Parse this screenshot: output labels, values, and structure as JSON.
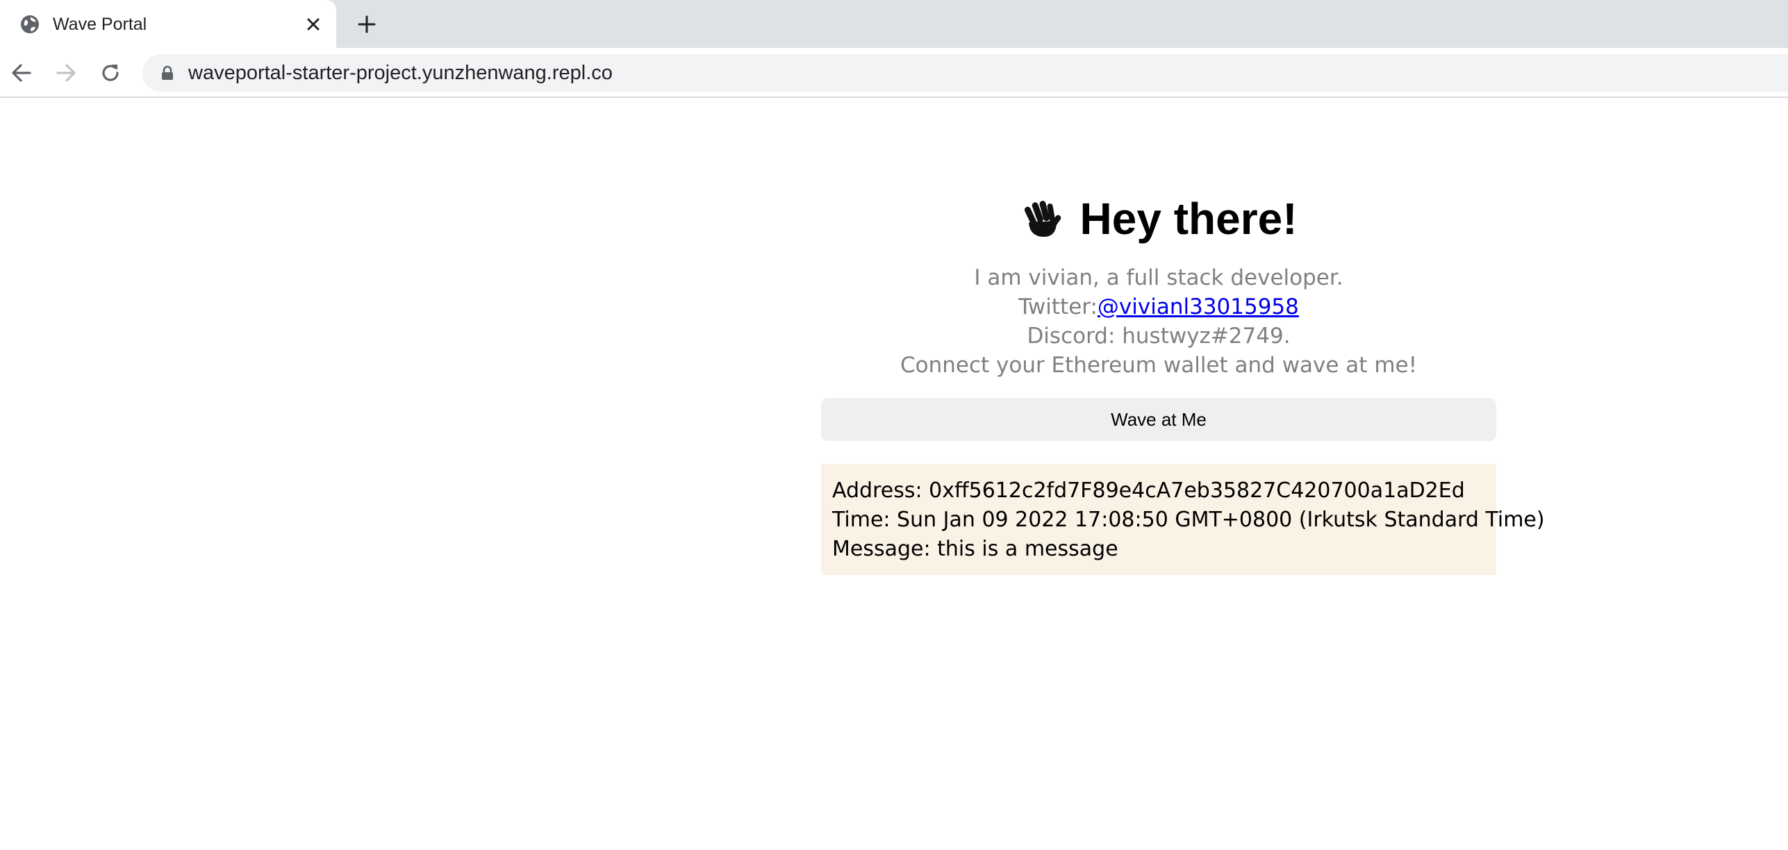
{
  "browser": {
    "tab": {
      "title": "Wave Portal"
    },
    "address_bar": {
      "url": "waveportal-starter-project.yunzhenwang.repl.co"
    }
  },
  "page": {
    "header": {
      "emoji": "👋",
      "title": "Hey there!"
    },
    "bio": {
      "line1": "I am vivian, a full stack developer.",
      "twitter_label": "Twitter:",
      "twitter_handle": "@vivianl33015958",
      "discord": "Discord: hustwyz#2749.",
      "cta": "Connect your Ethereum wallet and wave at me!"
    },
    "wave_button_label": "Wave at Me",
    "waves": [
      {
        "address": "Address: 0xff5612c2fd7F89e4cA7eb35827C420700a1aD2Ed",
        "time": "Time: Sun Jan 09 2022 17:08:50 GMT+0800 (Irkutsk Standard Time)",
        "message": "Message: this is a message"
      }
    ]
  },
  "colors": {
    "tabstrip": "#dee1e6",
    "omnibox": "#f1f3f4",
    "bio_text": "#808080",
    "link": "#0000ee",
    "button_bg": "#efefef",
    "card_bg": "#fbf2e6"
  }
}
